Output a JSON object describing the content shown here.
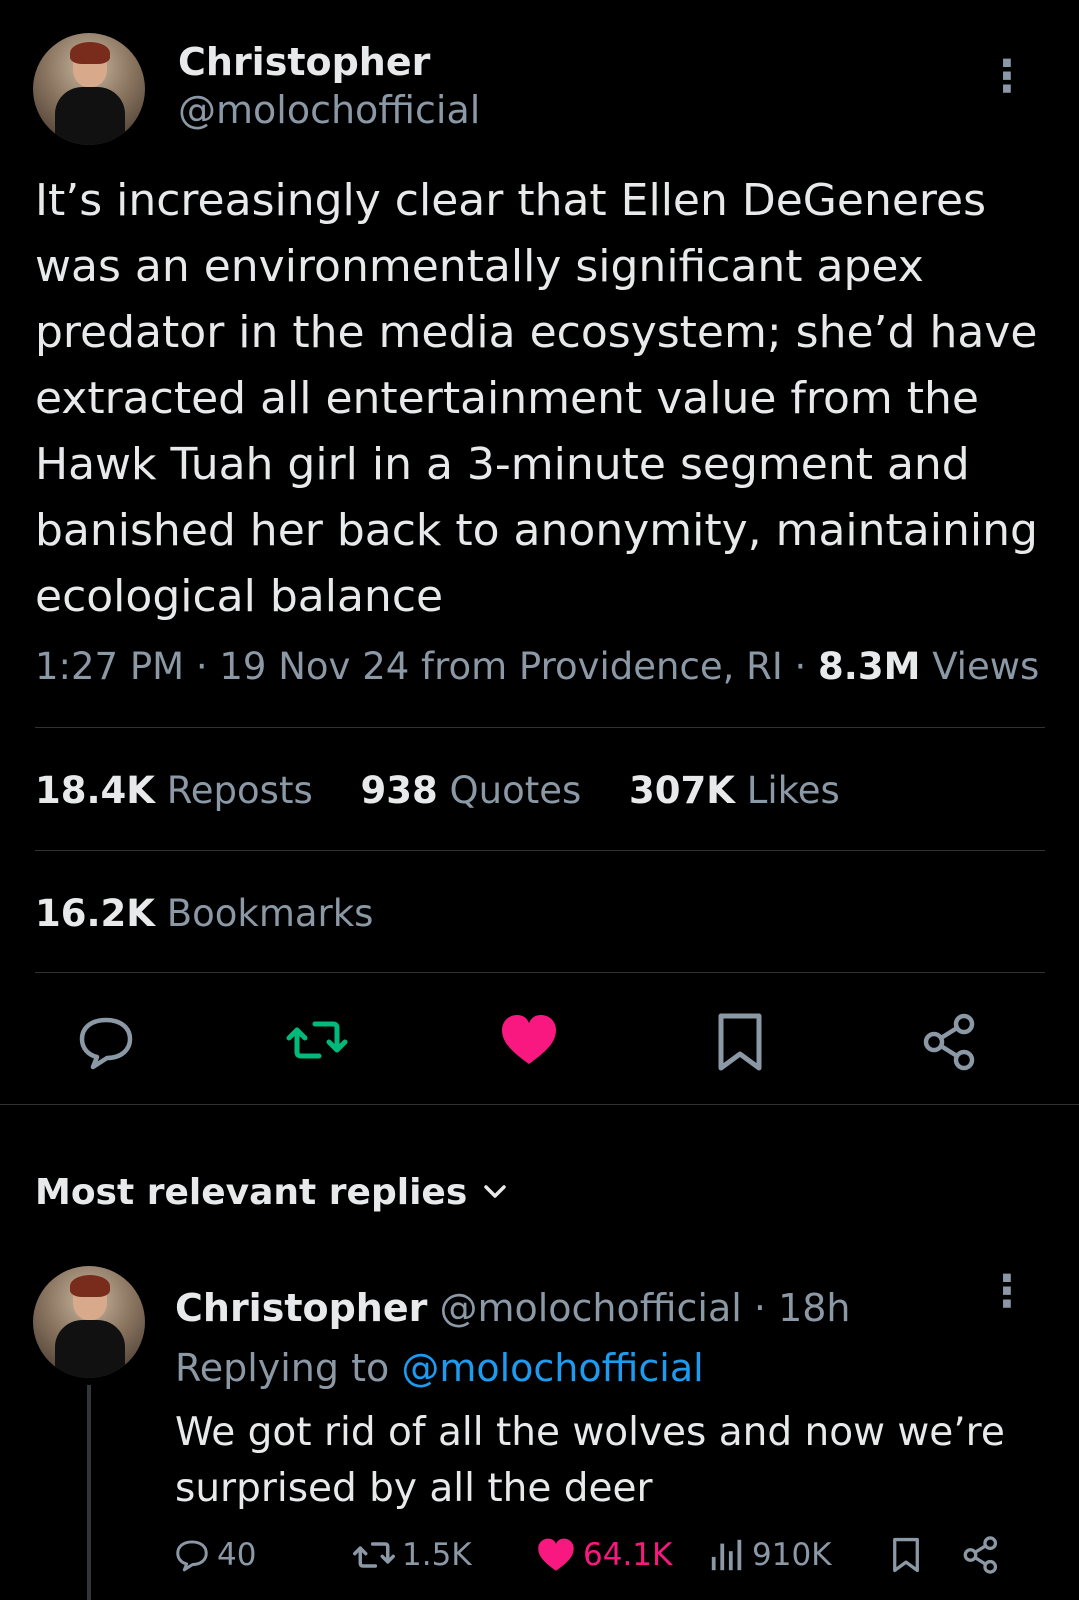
{
  "tweet": {
    "author_name": "Christopher",
    "author_handle": "@molochofficial",
    "text": "It’s increasingly clear that Ellen DeGeneres was an environmentally significant apex predator in the media ecosystem; she’d have extracted all entertainment value from the Hawk Tuah girl in a 3-minute segment and banished her back to anonymity, maintaining ecological balance",
    "time": "1:27 PM",
    "date_location": "19 Nov 24 from Providence, RI",
    "views_count": "8.3M",
    "views_label": "Views",
    "separator": "·",
    "more_glyph": "⋮"
  },
  "stats": {
    "reposts_count": "18.4K",
    "reposts_label": "Reposts",
    "quotes_count": "938",
    "quotes_label": "Quotes",
    "likes_count": "307K",
    "likes_label": "Likes",
    "bookmarks_count": "16.2K",
    "bookmarks_label": "Bookmarks"
  },
  "actions": {
    "icons": [
      "reply-icon",
      "repost-icon",
      "like-icon",
      "bookmark-icon",
      "share-icon"
    ],
    "repost_color": "#00ba7c",
    "like_color": "#f91880"
  },
  "replies": {
    "section_title": "Most relevant replies",
    "items": [
      {
        "author_name": "Christopher",
        "author_handle": "@molochofficial",
        "time": "· 18h",
        "replying_prefix": "Replying to",
        "replying_to": "@molochofficial",
        "text": "We got rid of all the wolves and now we’re surprised by all the deer",
        "reply_count": "40",
        "repost_count": "1.5K",
        "like_count": "64.1K",
        "view_count": "910K"
      }
    ]
  }
}
